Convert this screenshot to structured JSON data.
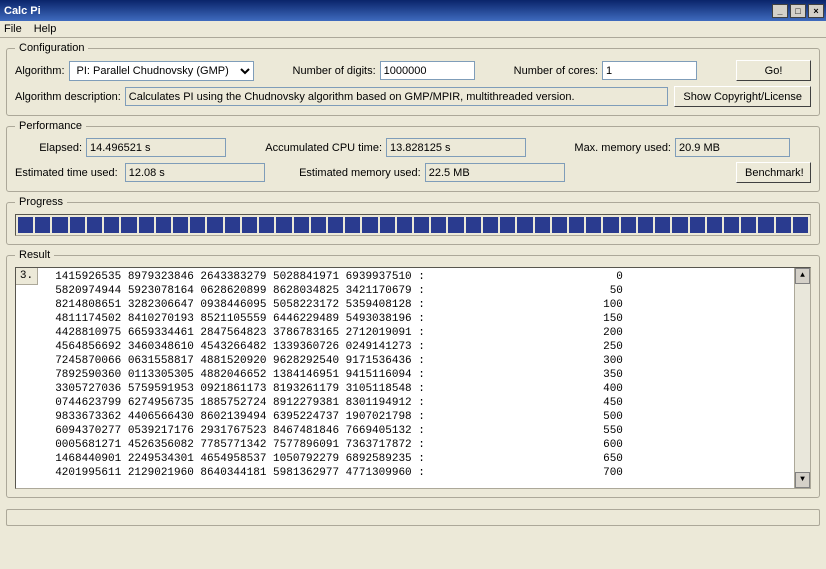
{
  "title": "Calc Pi",
  "menu": {
    "file": "File",
    "help": "Help"
  },
  "config": {
    "legend": "Configuration",
    "algorithm_label": "Algorithm:",
    "algorithm_value": "PI: Parallel Chudnovsky (GMP)",
    "digits_label": "Number of digits:",
    "digits_value": "1000000",
    "cores_label": "Number of cores:",
    "cores_value": "1",
    "go_label": "Go!",
    "desc_label": "Algorithm description:",
    "desc_value": "Calculates PI using the Chudnovsky algorithm based on GMP/MPIR, multithreaded version.",
    "copyright_label": "Show Copyright/License"
  },
  "perf": {
    "legend": "Performance",
    "elapsed_label": "Elapsed:",
    "elapsed_value": "14.496521 s",
    "cpu_label": "Accumulated CPU time:",
    "cpu_value": "13.828125 s",
    "mem_label": "Max. memory used:",
    "mem_value": "20.9 MB",
    "esttime_label": "Estimated time used:",
    "esttime_value": "12.08 s",
    "estmem_label": "Estimated memory used:",
    "estmem_value": "22.5 MB",
    "benchmark_label": "Benchmark!"
  },
  "progress": {
    "legend": "Progress"
  },
  "result": {
    "legend": "Result",
    "rowhdr": "3.",
    "lines": [
      {
        "digits": "1415926535 8979323846 2643383279 5028841971 6939937510",
        "idx": "0"
      },
      {
        "digits": "5820974944 5923078164 0628620899 8628034825 3421170679",
        "idx": "50"
      },
      {
        "digits": "8214808651 3282306647 0938446095 5058223172 5359408128",
        "idx": "100"
      },
      {
        "digits": "4811174502 8410270193 8521105559 6446229489 5493038196",
        "idx": "150"
      },
      {
        "digits": "4428810975 6659334461 2847564823 3786783165 2712019091",
        "idx": "200"
      },
      {
        "digits": "4564856692 3460348610 4543266482 1339360726 0249141273",
        "idx": "250"
      },
      {
        "digits": "7245870066 0631558817 4881520920 9628292540 9171536436",
        "idx": "300"
      },
      {
        "digits": "7892590360 0113305305 4882046652 1384146951 9415116094",
        "idx": "350"
      },
      {
        "digits": "3305727036 5759591953 0921861173 8193261179 3105118548",
        "idx": "400"
      },
      {
        "digits": "0744623799 6274956735 1885752724 8912279381 8301194912",
        "idx": "450"
      },
      {
        "digits": "9833673362 4406566430 8602139494 6395224737 1907021798",
        "idx": "500"
      },
      {
        "digits": "6094370277 0539217176 2931767523 8467481846 7669405132",
        "idx": "550"
      },
      {
        "digits": "0005681271 4526356082 7785771342 7577896091 7363717872",
        "idx": "600"
      },
      {
        "digits": "1468440901 2249534301 4654958537 1050792279 6892589235",
        "idx": "650"
      },
      {
        "digits": "4201995611 2129021960 8640344181 5981362977 4771309960",
        "idx": "700"
      }
    ]
  }
}
